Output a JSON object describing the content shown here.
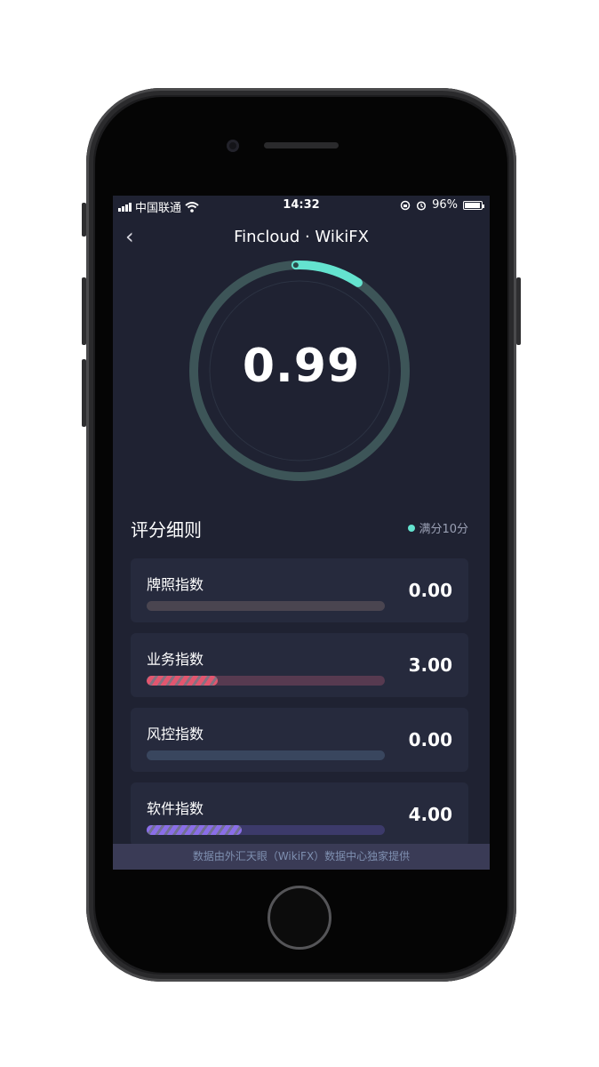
{
  "status": {
    "carrier": "中国联通",
    "time": "14:32",
    "battery": "96%",
    "battery_level": 0.96
  },
  "nav": {
    "back_glyph": "‹",
    "title": "Fincloud · WikiFX"
  },
  "score": {
    "value": "0.99",
    "max": 10
  },
  "section": {
    "title": "评分细则",
    "legend": "满分10分"
  },
  "indices": [
    {
      "label": "牌照指数",
      "value": "0.00",
      "level": 0.0,
      "track_color": "#4a4550",
      "fill_color": "#4a4550"
    },
    {
      "label": "业务指数",
      "value": "3.00",
      "level": 0.3,
      "track_color": "#573a50",
      "fill_color": "#e2566f"
    },
    {
      "label": "风控指数",
      "value": "0.00",
      "level": 0.0,
      "track_color": "#39465e",
      "fill_color": "#39465e"
    },
    {
      "label": "软件指数",
      "value": "4.00",
      "level": 0.4,
      "track_color": "#3c3a6a",
      "fill_color": "#8a6ee8"
    }
  ],
  "footer": {
    "text": "数据由外汇天眼（WikiFX）数据中心独家提供"
  },
  "colors": {
    "background": "#1f2232",
    "accent": "#64e3cf",
    "card": "#262a3d"
  }
}
